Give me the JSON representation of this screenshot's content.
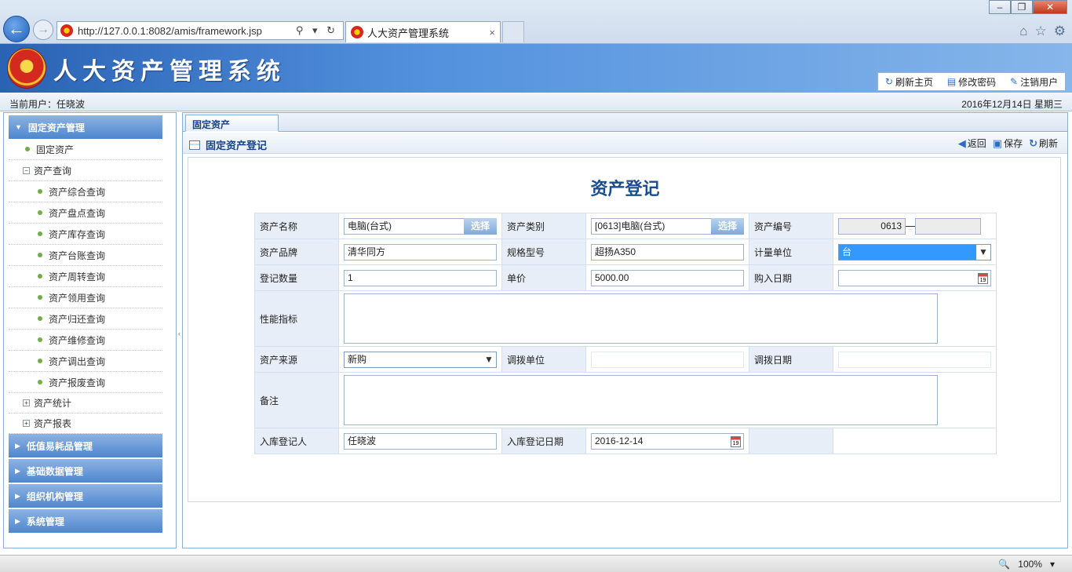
{
  "browser": {
    "url": "http://127.0.0.1:8082/amis/framework.jsp",
    "address_controls": "⚲ ▾ ↻",
    "tab_title": "人大资产管理系统",
    "tab_close": "×",
    "win_min": "–",
    "win_max": "❐",
    "win_close": "✕",
    "home_icon": "⌂",
    "star_icon": "☆",
    "gear_icon": "⚙",
    "back_glyph": "←",
    "fwd_glyph": "→"
  },
  "header": {
    "app_name": "人大资产管理系统",
    "buttons": [
      {
        "icon": "refresh-icon",
        "glyph": "↻",
        "label": "刷新主页"
      },
      {
        "icon": "password-icon",
        "glyph": "▤",
        "label": "修改密码"
      },
      {
        "icon": "logout-icon",
        "glyph": "✎",
        "label": "注销用户"
      }
    ]
  },
  "userbar": {
    "current_user": "当前用户：任晓波",
    "date": "2016年12月14日  星期三"
  },
  "sidebar": {
    "sections": [
      {
        "label": "固定资产管理",
        "expanded": true
      },
      {
        "label": "低值易耗品管理",
        "expanded": false
      },
      {
        "label": "基础数据管理",
        "expanded": false
      },
      {
        "label": "组织机构管理",
        "expanded": false
      },
      {
        "label": "系统管理",
        "expanded": false
      }
    ],
    "expanded_tri": "▼",
    "collapsed_tri": "▶",
    "minus": "−",
    "plus": "+",
    "items": {
      "fixed_assets": "固定资产",
      "asset_query": "资产查询",
      "query_children": [
        "资产综合查询",
        "资产盘点查询",
        "资产库存查询",
        "资产台账查询",
        "资产周转查询",
        "资产领用查询",
        "资产归还查询",
        "资产维修查询",
        "资产调出查询",
        "资产报废查询"
      ],
      "asset_stats": "资产统计",
      "asset_report": "资产报表"
    }
  },
  "main": {
    "tab_label": "固定资产",
    "form_bar_title": "固定资产登记",
    "actions": [
      {
        "icon": "back-icon",
        "glyph": "◀",
        "label": "返回"
      },
      {
        "icon": "save-icon",
        "glyph": "▣",
        "label": "保存"
      },
      {
        "icon": "refresh-icon",
        "glyph": "↻",
        "label": "刷新"
      }
    ],
    "page_title": "资产登记"
  },
  "form": {
    "asset_name": {
      "label": "资产名称",
      "value": "电脑(台式)",
      "button": "选择"
    },
    "asset_category": {
      "label": "资产类别",
      "value": "[0613]电脑(台式)",
      "button": "选择"
    },
    "asset_code": {
      "label": "资产编号",
      "value": "0613",
      "suffix": ""
    },
    "brand": {
      "label": "资产品牌",
      "value": "清华同方"
    },
    "model": {
      "label": "规格型号",
      "value": "超扬A350"
    },
    "unit": {
      "label": "计量单位",
      "value": "台"
    },
    "quantity": {
      "label": "登记数量",
      "value": "1"
    },
    "price": {
      "label": "单价",
      "value": "5000.00"
    },
    "purchase_date": {
      "label": "购入日期",
      "value": ""
    },
    "performance": {
      "label": "性能指标",
      "value": ""
    },
    "source": {
      "label": "资产来源",
      "value": "新购"
    },
    "transfer_unit": {
      "label": "调拨单位",
      "value": ""
    },
    "transfer_date": {
      "label": "调拨日期",
      "value": ""
    },
    "remark": {
      "label": "备注",
      "value": ""
    },
    "registrar": {
      "label": "入库登记人",
      "value": "任晓波"
    },
    "register_date": {
      "label": "入库登记日期",
      "value": "2016-12-14"
    },
    "calendar_day": "19",
    "dropdown_arrow": "▼"
  },
  "statusbar": {
    "zoom": "100%",
    "zoom_icon": "🔍",
    "zoom_arrow": "▾"
  },
  "colors": {
    "header_start": "#2a62b4",
    "header_end": "#86b6ea",
    "accordion": "#4e86cd",
    "label_bg": "#e8eef7",
    "title_text": "#1a4d8f",
    "select_highlight": "#3399ff"
  }
}
